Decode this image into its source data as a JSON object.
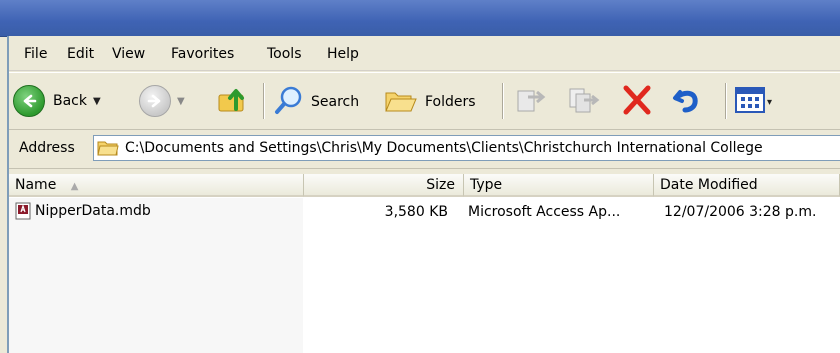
{
  "menu": [
    "File",
    "Edit",
    "View",
    "Favorites",
    "Tools",
    "Help"
  ],
  "toolbar": {
    "back_label": "Back",
    "search_label": "Search",
    "folders_label": "Folders"
  },
  "address": {
    "label": "Address",
    "value": "C:\\Documents and Settings\\Chris\\My Documents\\Clients\\Christchurch International College"
  },
  "columns": [
    "Name",
    "Size",
    "Type",
    "Date Modified"
  ],
  "files": [
    {
      "name": "NipperData.mdb",
      "size": "3,580 KB",
      "type": "Microsoft Access Ap...",
      "modified": "12/07/2006 3:28 p.m.",
      "icon": "access-db-icon"
    }
  ],
  "colors": {
    "title_bar": "#3f63b4",
    "chrome": "#ece9d8",
    "back_green": "#2e9a2e",
    "delete_red": "#e0281e",
    "undo_blue": "#1e5fc8"
  }
}
